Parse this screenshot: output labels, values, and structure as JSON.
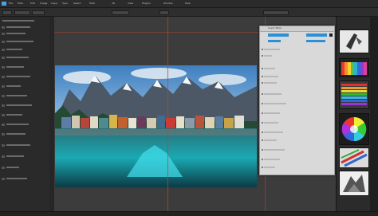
{
  "menubar": {
    "items": [
      "File",
      "Filter",
      "Edit",
      "Image",
      "Layer",
      "Type",
      "Select",
      "Filter",
      "3D",
      "View",
      "Plugins",
      "Window",
      "Help"
    ]
  },
  "document": {
    "subject": "mountain lake village photograph"
  },
  "dialog": {
    "title": "Layer Style",
    "accent_color": "#2d8fd5"
  },
  "colors": {
    "app_bg": "#232323",
    "panel_bg": "#2a2a2a",
    "canvas_bg": "#3c3c3c",
    "guide": "#b8472a",
    "dialog_bg": "#d9d9d9"
  },
  "right_panel": {
    "thumbnails": [
      "pen-icon",
      "color-wheel-icon",
      "gradient-swatches",
      "hue-wheel",
      "brush-strokes",
      "texture-preview"
    ]
  }
}
